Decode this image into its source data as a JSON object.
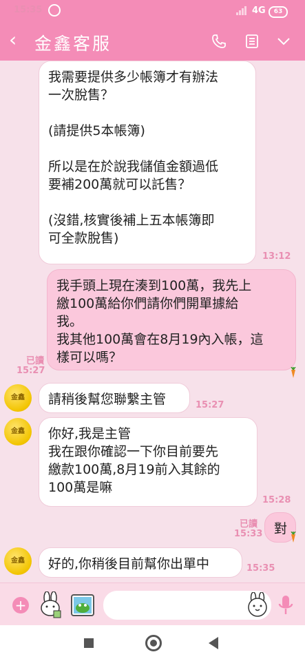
{
  "status_bar": {
    "time": "15:35",
    "network": "4G",
    "battery": "63"
  },
  "header": {
    "title": "金鑫客服",
    "back_icon": "‹"
  },
  "messages": [
    {
      "direction": "incoming",
      "text": "我需要提供多少帳簿才有辦法\n一次脫售？\n\n(請提供5本帳簿)\n\n所以是在於說我儲值金額過低\n要補200萬就可以託售？\n\n(沒錯,核實後補上五本帳簿即\n可全款脫售)",
      "time": "13:12"
    },
    {
      "direction": "outgoing",
      "text": "我手頭上現在湊到100萬，我先上\n繳100萬給你們請你們開單據給\n我。\n我其他100萬會在8月19內入帳，這\n樣可以嗎？",
      "read": "已讀",
      "time": "15:27"
    },
    {
      "direction": "incoming",
      "avatar": "金鑫",
      "text": "請稍後幫您聯繫主管",
      "time": "15:27"
    },
    {
      "direction": "incoming",
      "avatar": "金鑫",
      "text": "你好,我是主管\n我在跟你確認一下你目前要先\n繳款100萬,8月19前入其餘的\n100萬是嘛",
      "time": "15:28"
    },
    {
      "direction": "outgoing",
      "text": "對",
      "read": "已讀",
      "time": "15:33"
    },
    {
      "direction": "incoming",
      "avatar": "金鑫",
      "text": "好的,你稍後目前幫你出單中",
      "time": "15:35"
    }
  ],
  "input": {
    "placeholder": ""
  },
  "colors": {
    "header": "#f48cb7",
    "chat_background": "#f7e1ea",
    "outgoing_bubble": "#fbc8dc",
    "incoming_bubble": "#ffffff",
    "accent_text": "#e98fb2"
  },
  "icons": [
    "alarm-icon",
    "signal-icon",
    "battery-icon",
    "back-icon",
    "phone-icon",
    "notes-icon",
    "chevron-down-icon",
    "plus-icon",
    "sticker-icon",
    "image-icon",
    "emoji-icon",
    "microphone-icon",
    "carrot-icon"
  ]
}
